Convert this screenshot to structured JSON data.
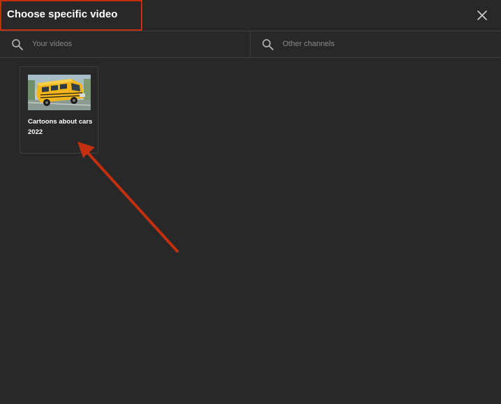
{
  "dialog": {
    "title": "Choose specific video",
    "close_icon": "close-icon"
  },
  "search": {
    "your_videos_placeholder": "Your videos",
    "other_channels_placeholder": "Other channels",
    "icon": "search-icon"
  },
  "videos": [
    {
      "title": "Cartoons about cars 2022",
      "thumbnail_subject": "yellow school bus toy"
    }
  ],
  "annotation": {
    "color": "#c4300f"
  },
  "colors": {
    "background": "#282828",
    "divider": "#3f3f3f",
    "text": "#ffffff",
    "placeholder": "#8a8a8a"
  }
}
